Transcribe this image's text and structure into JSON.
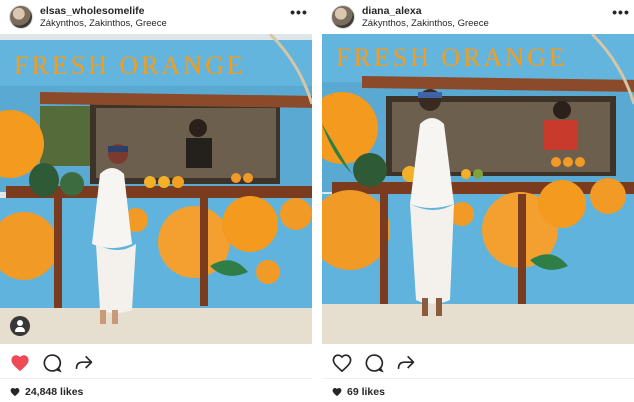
{
  "posts": [
    {
      "username": "elsas_wholesomelife",
      "location": "Zákynthos, Zakinthos, Greece",
      "more_label": "•••",
      "sign_text": "FRESH ORANGE",
      "likes_text": "24,848 likes",
      "liked": true,
      "like_color": "#ed4956"
    },
    {
      "username": "diana_alexa",
      "location": "Zákynthos, Zakinthos, Greece",
      "more_label": "•••",
      "sign_text": "FRESH ORANGE",
      "likes_text": "69 likes",
      "liked": false,
      "like_color": "#262626"
    }
  ],
  "icons": {
    "like": "heart-icon",
    "comment": "comment-icon",
    "share": "share-icon",
    "more": "more-options-icon",
    "user_tag": "user-tag-icon"
  },
  "colors": {
    "stand_blue": "#5fb3dc",
    "orange": "#f29a26",
    "wood": "#7a3b1f",
    "sand": "#e6dfcf",
    "dress": "#f7f5f2"
  }
}
